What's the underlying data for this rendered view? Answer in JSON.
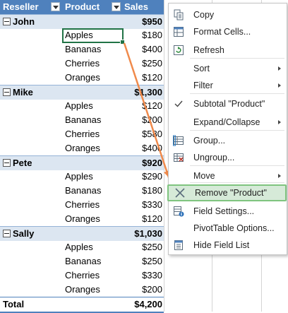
{
  "pivot": {
    "headers": {
      "reseller": "Reseller",
      "product": "Product",
      "sales": "Sales"
    },
    "groups": [
      {
        "reseller": "John",
        "total": "$950",
        "items": [
          {
            "product": "Apples",
            "sales": "$180"
          },
          {
            "product": "Bananas",
            "sales": "$400"
          },
          {
            "product": "Cherries",
            "sales": "$250"
          },
          {
            "product": "Oranges",
            "sales": "$120"
          }
        ]
      },
      {
        "reseller": "Mike",
        "total": "$1,300",
        "items": [
          {
            "product": "Apples",
            "sales": "$120"
          },
          {
            "product": "Bananas",
            "sales": "$200"
          },
          {
            "product": "Cherries",
            "sales": "$580"
          },
          {
            "product": "Oranges",
            "sales": "$400"
          }
        ]
      },
      {
        "reseller": "Pete",
        "total": "$920",
        "items": [
          {
            "product": "Apples",
            "sales": "$290"
          },
          {
            "product": "Bananas",
            "sales": "$180"
          },
          {
            "product": "Cherries",
            "sales": "$330"
          },
          {
            "product": "Oranges",
            "sales": "$120"
          }
        ]
      },
      {
        "reseller": "Sally",
        "total": "$1,030",
        "items": [
          {
            "product": "Apples",
            "sales": "$250"
          },
          {
            "product": "Bananas",
            "sales": "$250"
          },
          {
            "product": "Cherries",
            "sales": "$330"
          },
          {
            "product": "Oranges",
            "sales": "$200"
          }
        ]
      }
    ],
    "grand_total": {
      "label": "Total",
      "value": "$4,200"
    }
  },
  "context_menu": {
    "items": [
      {
        "label": "Copy",
        "icon": "copy-icon",
        "submenu": false
      },
      {
        "label": "Format Cells...",
        "icon": "format-cells-icon",
        "submenu": false
      },
      {
        "label": "Refresh",
        "icon": "refresh-icon",
        "submenu": false
      },
      {
        "label": "Sort",
        "icon": "",
        "submenu": true
      },
      {
        "label": "Filter",
        "icon": "",
        "submenu": true
      },
      {
        "label": "Subtotal \"Product\"",
        "icon": "checkmark-icon",
        "submenu": false
      },
      {
        "label": "Expand/Collapse",
        "icon": "",
        "submenu": true
      },
      {
        "label": "Group...",
        "icon": "group-icon",
        "submenu": false
      },
      {
        "label": "Ungroup...",
        "icon": "ungroup-icon",
        "submenu": false
      },
      {
        "label": "Move",
        "icon": "",
        "submenu": true
      },
      {
        "label": "Remove \"Product\"",
        "icon": "remove-x-icon",
        "submenu": false,
        "highlighted": true
      },
      {
        "label": "Field Settings...",
        "icon": "field-settings-icon",
        "submenu": false
      },
      {
        "label": "PivotTable Options...",
        "icon": "",
        "submenu": false
      },
      {
        "label": "Hide Field List",
        "icon": "field-list-icon",
        "submenu": false
      }
    ]
  },
  "colors": {
    "header_bg": "#4f81bd",
    "group_bg": "#dce6f1",
    "highlight_bg": "#d6ead8",
    "highlight_border": "#7fc47f",
    "callout_arrow": "#f08a4b",
    "selection": "#217346"
  }
}
